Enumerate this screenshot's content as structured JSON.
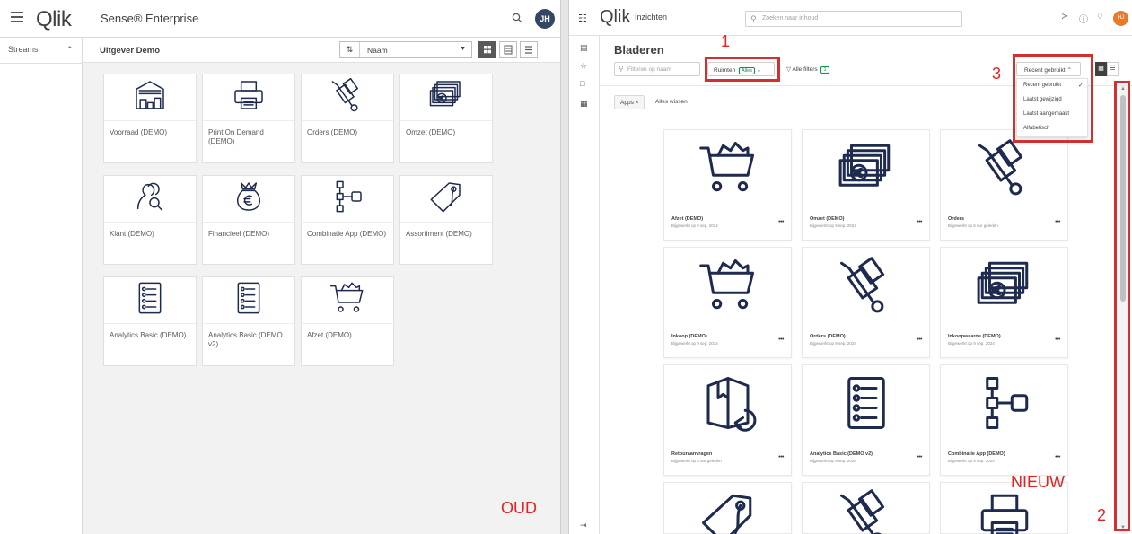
{
  "old": {
    "logo": "Qlik",
    "product": "Sense® Enterprise",
    "avatar": "JH",
    "sidebar_label": "Streams",
    "stream_title": "Uitgever Demo",
    "sort_value": "Naam",
    "tag": "OUD",
    "apps": [
      {
        "name": "Voorraad (DEMO)",
        "icon": "warehouse-icon"
      },
      {
        "name": "Print On Demand (DEMO)",
        "icon": "printer-icon"
      },
      {
        "name": "Orders (DEMO)",
        "icon": "hand-truck-icon"
      },
      {
        "name": "Omzet (DEMO)",
        "icon": "money-stack-icon"
      },
      {
        "name": "Klant (DEMO)",
        "icon": "customer-search-icon"
      },
      {
        "name": "Financieel (DEMO)",
        "icon": "money-bag-icon"
      },
      {
        "name": "Combinatie App (DEMO)",
        "icon": "flow-diagram-icon"
      },
      {
        "name": "Assortiment (DEMO)",
        "icon": "price-tag-icon"
      },
      {
        "name": "Analytics Basic (DEMO)",
        "icon": "checklist-icon"
      },
      {
        "name": "Analytics Basic (DEMO v2)",
        "icon": "checklist-icon"
      },
      {
        "name": "Afzet (DEMO)",
        "icon": "shopping-cart-icon"
      }
    ]
  },
  "new": {
    "logo": "Qlik",
    "product": "Inzichten",
    "search_placeholder": "Zoeken naar inhoud",
    "avatar": "HJ",
    "heading": "Bladeren",
    "filter_placeholder": "Filteren op naam",
    "spaces_label": "Ruimten",
    "spaces_pill": "Alles",
    "all_filters_label": "Alle filters",
    "all_filters_count": "1",
    "sort_value": "Recent gebruikt",
    "sort_options": [
      "Recent gebruikt",
      "Laatst gewijzigd",
      "Laatst aangemaakt",
      "Alfabetisch"
    ],
    "chip": "Apps",
    "clear_all": "Alles wissen",
    "tag": "NIEUW",
    "apps": [
      {
        "name": "Afzet (DEMO)",
        "sub": "Bijgewerkt op 9 sep. 2024",
        "icon": "shopping-cart-icon"
      },
      {
        "name": "Omzet (DEMO)",
        "sub": "Bijgewerkt op 9 sep. 2024",
        "icon": "money-stack-icon"
      },
      {
        "name": "Orders",
        "sub": "Bijgewerkt op 6 uur geleden",
        "icon": "hand-truck-icon"
      },
      {
        "name": "Inkoop (DEMO)",
        "sub": "Bijgewerkt op 9 sep. 2024",
        "icon": "shopping-cart-icon"
      },
      {
        "name": "Orders (DEMO)",
        "sub": "Bijgewerkt op 9 sep. 2024",
        "icon": "hand-truck-icon"
      },
      {
        "name": "Inkoopwaarde (DEMO)",
        "sub": "Bijgewerkt op 9 sep. 2024",
        "icon": "money-stack-icon"
      },
      {
        "name": "Retouraanvragen",
        "sub": "Bijgewerkt op 5 uur geleden",
        "icon": "return-box-icon"
      },
      {
        "name": "Analytics Basic (DEMO v2)",
        "sub": "Bijgewerkt op 9 sep. 2024",
        "icon": "checklist-icon"
      },
      {
        "name": "Combinatie App (DEMO)",
        "sub": "Bijgewerkt op 9 sep. 2024",
        "icon": "flow-diagram-icon"
      }
    ],
    "partial_apps": [
      {
        "icon": "price-tag-icon"
      },
      {
        "icon": "hand-truck-icon"
      },
      {
        "icon": "printer-icon"
      }
    ]
  },
  "annotations": [
    "1",
    "2",
    "3"
  ],
  "colors": {
    "qlik_green": "#009845",
    "annotation_red": "#d32f2f",
    "icon_navy": "#1f2a4f"
  }
}
